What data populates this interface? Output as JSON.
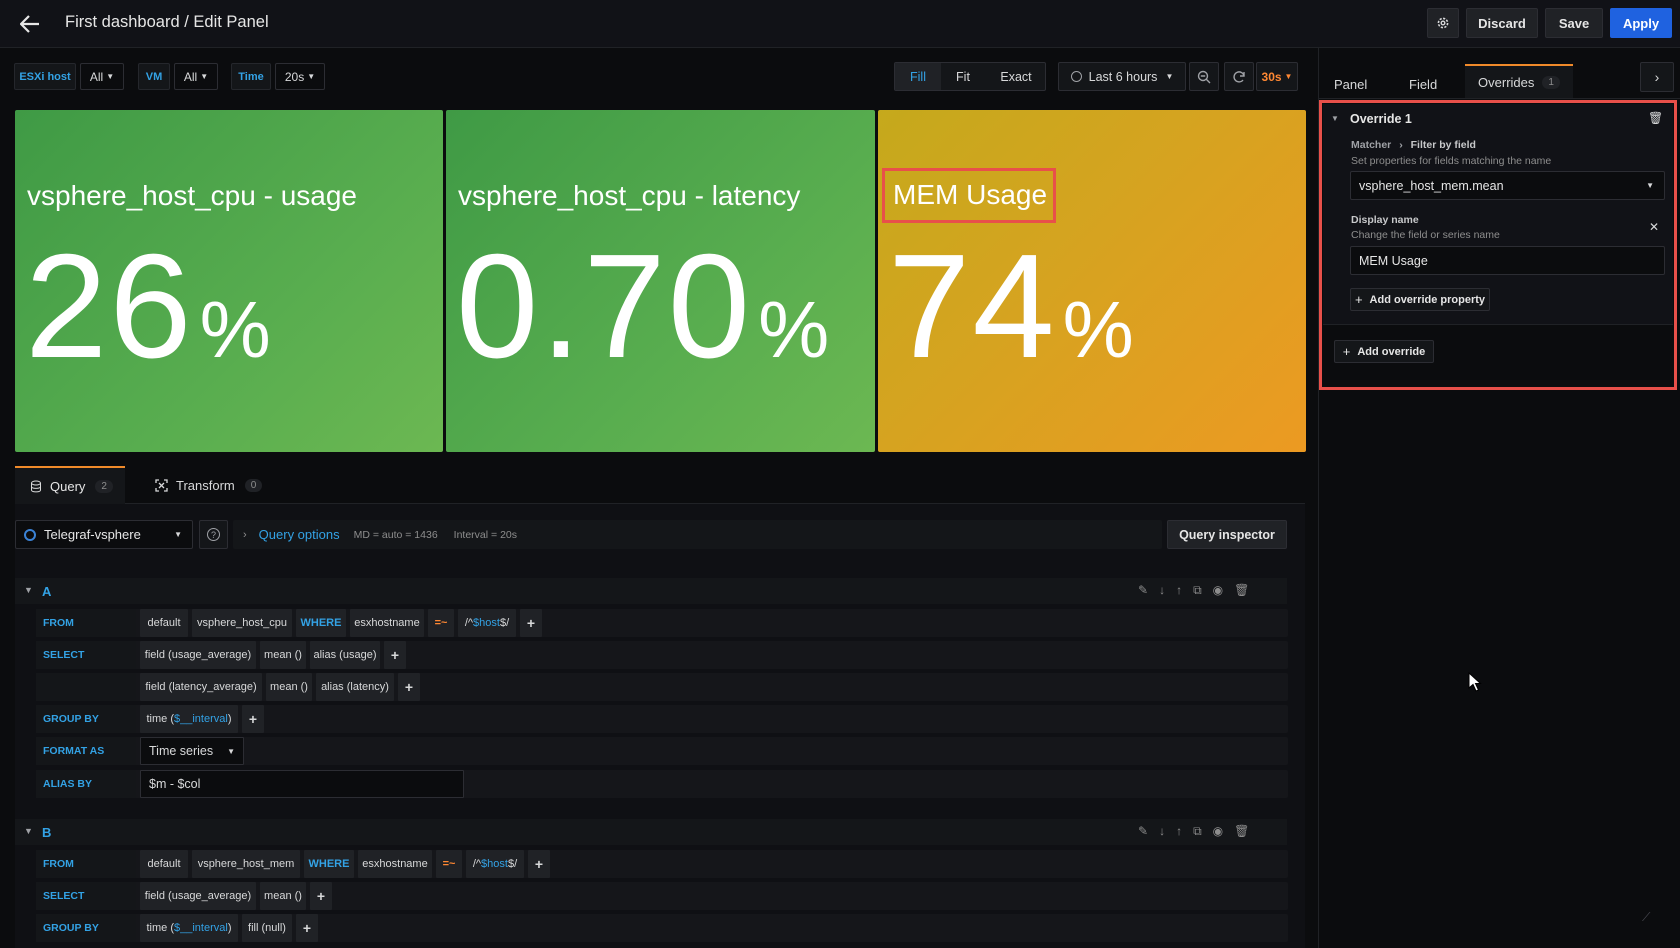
{
  "header": {
    "title": "First dashboard / Edit Panel",
    "discard": "Discard",
    "save": "Save",
    "apply": "Apply"
  },
  "vars": [
    {
      "label": "ESXi host",
      "value": "All"
    },
    {
      "label": "VM",
      "value": "All"
    },
    {
      "label": "Time",
      "value": "20s"
    }
  ],
  "toolbar": {
    "fill": "Fill",
    "fit": "Fit",
    "exact": "Exact",
    "time_range": "Last 6 hours",
    "refresh": "30s"
  },
  "panels": [
    {
      "title": "vsphere_host_cpu - usage",
      "value": "26",
      "unit": "%",
      "color": "#56a64b"
    },
    {
      "title": "vsphere_host_cpu - latency",
      "value": "0.70",
      "unit": "%",
      "color": "#56a64b"
    },
    {
      "title": "MEM Usage",
      "value": "74",
      "unit": "%",
      "color": "#e0b400"
    }
  ],
  "query_tabs": {
    "query": "Query",
    "query_count": "2",
    "transform": "Transform",
    "transform_count": "0"
  },
  "query_bar": {
    "datasource": "Telegraf-vsphere",
    "options": "Query options",
    "md": "MD = auto = 1436",
    "interval": "Interval = 20s",
    "inspector": "Query inspector"
  },
  "qa": {
    "id": "A",
    "from": "FROM",
    "f_db": "default",
    "f_meas": "vsphere_host_cpu",
    "where": "WHERE",
    "w_key": "esxhostname",
    "w_op": "=~",
    "w_pre": "/^",
    "w_var": "$host",
    "w_post": "$/",
    "select": "SELECT",
    "s1_field": "field (usage_average)",
    "s1_mean": "mean ()",
    "s1_alias": "alias (usage)",
    "s2_field": "field (latency_average)",
    "s2_mean": "mean ()",
    "s2_alias": "alias (latency)",
    "group": "GROUP BY",
    "g_pre": "time (",
    "g_var": "$__interval",
    "g_post": ")",
    "format": "FORMAT AS",
    "format_val": "Time series",
    "alias": "ALIAS BY",
    "alias_val": "$m - $col"
  },
  "qb": {
    "id": "B",
    "from": "FROM",
    "f_db": "default",
    "f_meas": "vsphere_host_mem",
    "where": "WHERE",
    "w_key": "esxhostname",
    "w_op": "=~",
    "w_pre": "/^",
    "w_var": "$host",
    "w_post": "$/",
    "select": "SELECT",
    "s1_field": "field (usage_average)",
    "s1_mean": "mean ()",
    "group": "GROUP BY",
    "g_pre": "time (",
    "g_var": "$__interval",
    "g_post": ")",
    "g_fill": "fill (null)"
  },
  "side": {
    "tab_panel": "Panel",
    "tab_field": "Field",
    "tab_overrides": "Overrides",
    "overrides_count": "1",
    "override_title": "Override 1",
    "matcher": "Matcher",
    "filter": "Filter by field",
    "matcher_desc": "Set properties for fields matching the name",
    "matcher_val": "vsphere_host_mem.mean",
    "display_name": "Display name",
    "display_desc": "Change the field or series name",
    "display_val": "MEM Usage",
    "add_prop": "Add override property",
    "add_override": "Add override"
  }
}
